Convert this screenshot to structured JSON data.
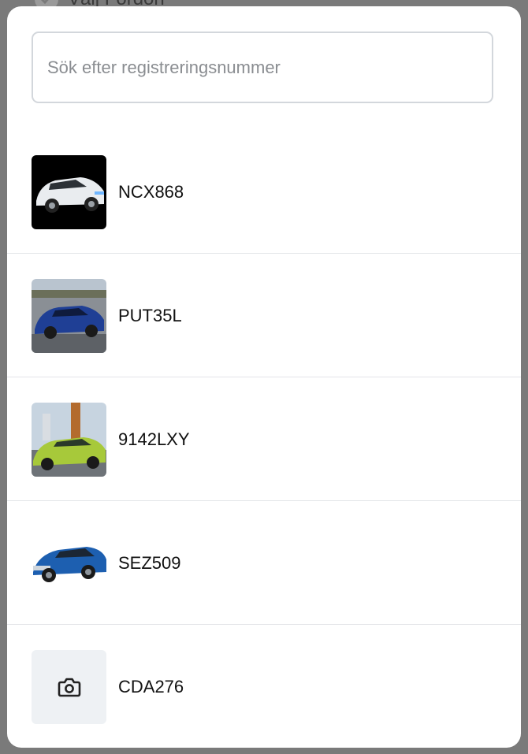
{
  "background": {
    "title": "Välj Fordon"
  },
  "search": {
    "placeholder": "Sök efter registreringsnummer"
  },
  "vehicles": [
    {
      "plate": "NCX868",
      "image": "white-suv-photo"
    },
    {
      "plate": "PUT35L",
      "image": "blue-suv-photo"
    },
    {
      "plate": "9142LXY",
      "image": "green-suv-photo"
    },
    {
      "plate": "SEZ509",
      "image": "blue-crossover-photo"
    },
    {
      "plate": "CDA276",
      "image": "camera-icon"
    }
  ],
  "colors": {
    "overlay": "#7a7a7a",
    "sheet": "#ffffff",
    "divider": "#e3e5e8",
    "placeholder_bg": "#eef1f4"
  }
}
